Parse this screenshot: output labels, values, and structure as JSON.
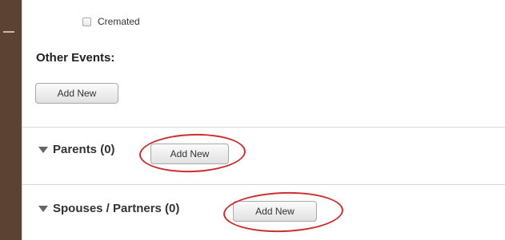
{
  "cremated": {
    "label": "Cremated",
    "checked": false
  },
  "other_events": {
    "title": "Other Events:",
    "add_new_label": "Add New"
  },
  "parents": {
    "title": "Parents (0)",
    "add_new_label": "Add New"
  },
  "spouses": {
    "title": "Spouses / Partners (0)",
    "add_new_label": "Add New"
  },
  "highlight_color": "#cc2e2e",
  "sidebar_color": "#5b4232"
}
